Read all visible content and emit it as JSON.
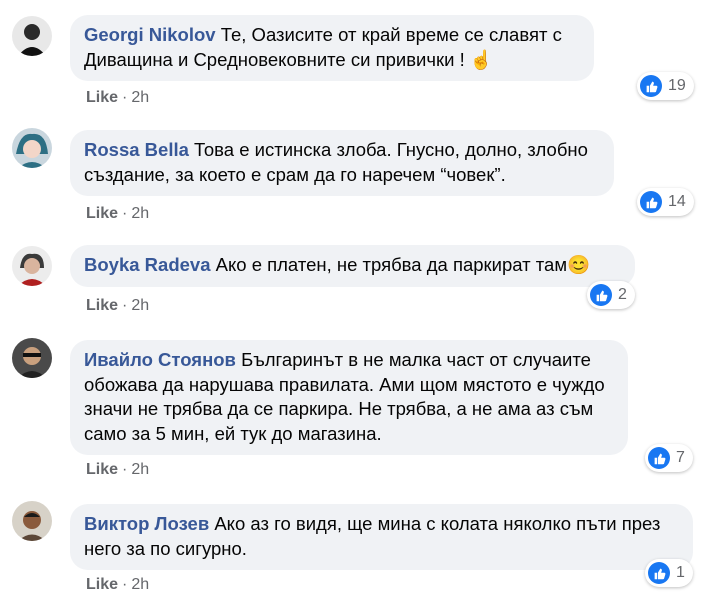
{
  "comments": [
    {
      "author": "Georgi Nikolov",
      "text": "Те, Оазисите от край време се славят с Диващина и Средновековните си привички ! ",
      "emoji": "☝️",
      "like_label": "Like",
      "separator": "·",
      "time": "2h",
      "reaction_count": "19"
    },
    {
      "author": "Rossa Bella",
      "text": "Това е истинска злоба. Гнусно, долно, злобно създание, за което е срам да го наречем “човек”.",
      "like_label": "Like",
      "separator": "·",
      "time": "2h",
      "reaction_count": "14"
    },
    {
      "author": "Boyka Radeva",
      "text": "Ако е платен, не трябва да паркират там",
      "emoji": "😊",
      "like_label": "Like",
      "separator": "·",
      "time": "2h",
      "reaction_count": "2"
    },
    {
      "author": "Ивайло Стоянов",
      "text": "Българинът в не малка част от случаите обожава да нарушава правилата. Ами щом мястото е чуждо значи не трябва да се паркира. Не трябва, а не ама аз съм само за 5 мин, ей тук до магазина.",
      "like_label": "Like",
      "separator": "·",
      "time": "2h",
      "reaction_count": "7"
    },
    {
      "author": "Виктор Лозев",
      "text": "Ако аз го видя, ще мина с колата няколко пъти през него за по сигурно.",
      "like_label": "Like",
      "separator": "·",
      "time": "2h",
      "reaction_count": "1"
    }
  ],
  "colors": {
    "author": "#385898",
    "bubble_bg": "#f0f2f5",
    "meta": "#65676b",
    "like_blue": "#1877f2"
  }
}
